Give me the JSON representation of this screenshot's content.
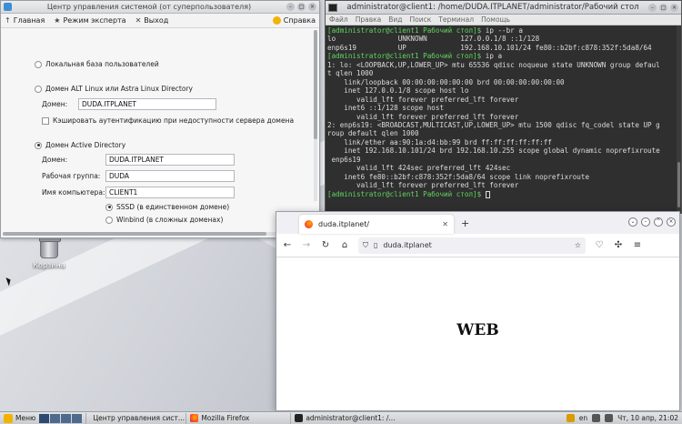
{
  "desktop": {
    "trash_label": "Корзина"
  },
  "control_center": {
    "title": "Центр управления системой (от суперпользователя)",
    "toolbar": {
      "home": "Главная",
      "expert": "Режим эксперта",
      "exit": "Выход",
      "help": "Справка"
    },
    "options": {
      "local": "Локальная база пользователей",
      "alt_domain": "Домен ALT Linux или Astra Linux Directory",
      "ad_domain": "Домен Active Directory",
      "selected": "ad_domain"
    },
    "alt_section": {
      "domain_label": "Домен:",
      "domain_value": "DUDA.ITPLANET",
      "cache_label": "Кэшировать аутентификацию при недоступности сервера домена"
    },
    "ad_section": {
      "domain_label": "Домен:",
      "domain_value": "DUDA.ITPLANET",
      "workgroup_label": "Рабочая группа:",
      "workgroup_value": "DUDA",
      "computer_label": "Имя компьютера:",
      "computer_value": "CLIENT1",
      "sssd_label": "SSSD (в единственном домене)",
      "winbind_label": "Winbind (в сложных доменах)"
    }
  },
  "terminal": {
    "title": "administrator@client1: /home/DUDA.ITPLANET/administrator/Рабочий стол",
    "menu": [
      "Файл",
      "Правка",
      "Вид",
      "Поиск",
      "Терминал",
      "Помощь"
    ],
    "lines": [
      {
        "prompt": "[administrator@client1 Рабочий стол]$",
        "text": " ip --br a"
      },
      {
        "text": "lo               UNKNOWN        127.0.0.1/8 ::1/128"
      },
      {
        "text": "enp6s19          UP             192.168.10.101/24 fe80::b2bf:c878:352f:5da8/64"
      },
      {
        "prompt": "[administrator@client1 Рабочий стол]$",
        "text": " ip a"
      },
      {
        "text": "1: lo: <LOOPBACK,UP,LOWER_UP> mtu 65536 qdisc noqueue state UNKNOWN group defaul"
      },
      {
        "text": "t qlen 1000"
      },
      {
        "text": "    link/loopback 00:00:00:00:00:00 brd 00:00:00:00:00:00"
      },
      {
        "text": "    inet 127.0.0.1/8 scope host lo"
      },
      {
        "text": "       valid_lft forever preferred_lft forever"
      },
      {
        "text": "    inet6 ::1/128 scope host"
      },
      {
        "text": "       valid_lft forever preferred_lft forever"
      },
      {
        "text": "2: enp6s19: <BROADCAST,MULTICAST,UP,LOWER_UP> mtu 1500 qdisc fq_codel state UP g"
      },
      {
        "text": "roup default qlen 1000"
      },
      {
        "text": "    link/ether aa:90:1a:d4:bb:99 brd ff:ff:ff:ff:ff:ff"
      },
      {
        "text": "    inet 192.168.10.101/24 brd 192.168.10.255 scope global dynamic noprefixroute"
      },
      {
        "text": " enp6s19"
      },
      {
        "text": "       valid_lft 424sec preferred_lft 424sec"
      },
      {
        "text": "    inet6 fe80::b2bf:c878:352f:5da8/64 scope link noprefixroute"
      },
      {
        "text": "       valid_lft forever preferred_lft forever"
      },
      {
        "prompt": "[administrator@client1 Рабочий стол]$",
        "text": " "
      }
    ]
  },
  "firefox": {
    "tab_title": "duda.itplanet/",
    "url": "duda.itplanet",
    "page_heading": "WEB"
  },
  "taskbar": {
    "menu_label": "Меню",
    "tasks": [
      "Центр управления сист...",
      "Mozilla Firefox",
      "administrator@client1: /..."
    ],
    "lang": "en",
    "clock": "Чт, 10 апр, 21:02"
  }
}
